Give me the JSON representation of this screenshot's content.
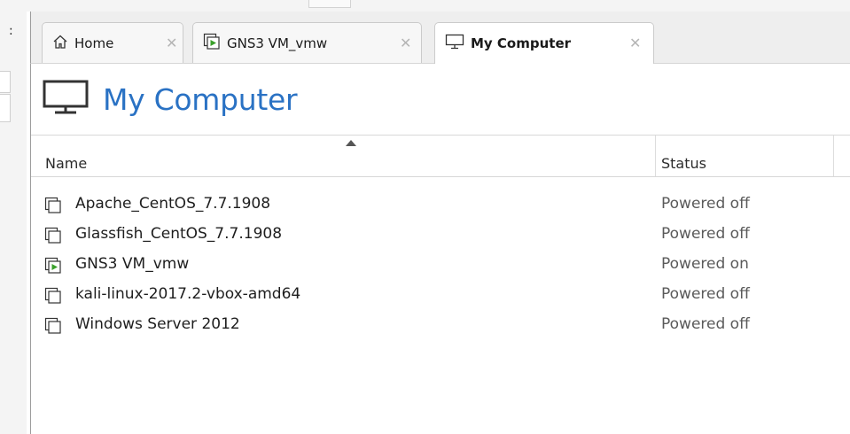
{
  "tabs": [
    {
      "label": "Home",
      "icon": "home-icon",
      "active": false
    },
    {
      "label": "GNS3 VM_vmw",
      "icon": "vm-running-icon",
      "active": false
    },
    {
      "label": "My Computer",
      "icon": "monitor-icon",
      "active": true
    }
  ],
  "close_glyph": "✕",
  "left_glyph": ":",
  "page_title": "My Computer",
  "table": {
    "columns": [
      "Name",
      "Status"
    ],
    "rows": [
      {
        "name": "Apache_CentOS_7.7.1908",
        "status": "Powered off",
        "running": false
      },
      {
        "name": "Glassfish_CentOS_7.7.1908",
        "status": "Powered off",
        "running": false
      },
      {
        "name": "GNS3 VM_vmw",
        "status": "Powered on",
        "running": true
      },
      {
        "name": "kali-linux-2017.2-vbox-amd64",
        "status": "Powered off",
        "running": false
      },
      {
        "name": "Windows Server 2012",
        "status": "Powered off",
        "running": false
      }
    ]
  },
  "colors": {
    "title_blue": "#2a72c4",
    "running_green": "#3aa02b"
  }
}
